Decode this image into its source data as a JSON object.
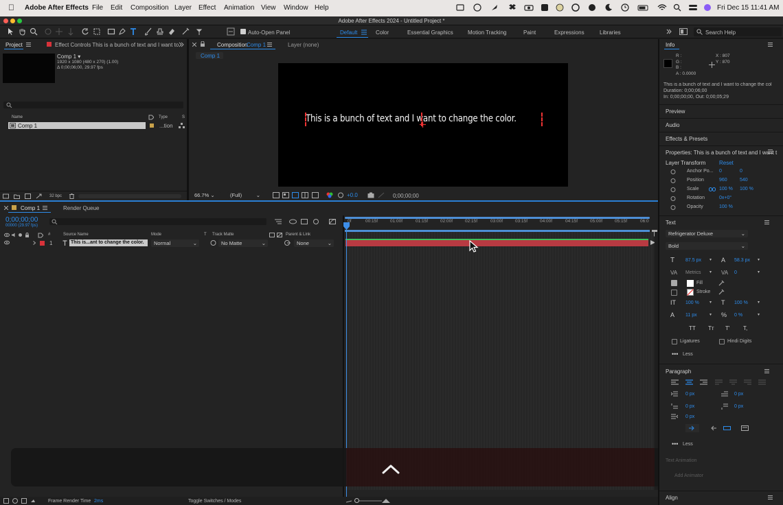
{
  "menubar": {
    "app_name": "Adobe After Effects",
    "items": [
      "File",
      "Edit",
      "Composition",
      "Layer",
      "Effect",
      "Animation",
      "View",
      "Window",
      "Help"
    ],
    "clock": "Fri Dec 15  11:41 AM"
  },
  "window": {
    "title": "Adobe After Effects 2024 - Untitled Project *"
  },
  "toolbar": {
    "auto_open_panel": "Auto-Open Panel",
    "workspaces": [
      "Default",
      "Color",
      "Essential Graphics",
      "Motion Tracking",
      "Paint",
      "Expressions",
      "Libraries"
    ],
    "active_workspace": "Default",
    "search_placeholder": "Search Help"
  },
  "project": {
    "tab_label": "Project",
    "effect_controls_label": "Effect Controls This is a bunch of text and I want to",
    "comp_name": "Comp 1 ▾",
    "comp_size": "1920 x 1080  (480 x 270) (1.00)",
    "comp_duration": "Δ 0;00;06;00, 29.97 fps",
    "col_name": "Name",
    "col_type": "Type",
    "col_s": "S",
    "item_name": "Comp 1",
    "item_type": "...tion",
    "bpc": "32 bpc"
  },
  "composition": {
    "tab_prefix": "Composition",
    "tab_name": "Comp 1",
    "layer_tab": "Layer (none)",
    "breadcrumb": "Comp 1",
    "canvas_text": "This is a bunch of text and I want to change the color.",
    "zoom": "66.7%",
    "resolution": "(Full)",
    "exposure": "+0.0",
    "timecode": "0;00;00;00"
  },
  "info": {
    "title": "Info",
    "r": "R :",
    "g": "G :",
    "b": "B :",
    "a": "A : 0.0000",
    "x": "X : 807",
    "y": "Y : 870",
    "layer_line": "This is a bunch of text and I want to change the col",
    "duration": "Duration: 0;00;06;00",
    "in_out": "In: 0;00;00;00, Out: 0;00;05;29",
    "preview": "Preview",
    "audio": "Audio",
    "effects": "Effects & Presets",
    "properties": "Properties: This is a bunch of text and I want t",
    "layer_transform": "Layer Transform",
    "reset": "Reset",
    "anchor_label": "Anchor Po...",
    "anchor_x": "0",
    "anchor_y": "0",
    "position_label": "Position",
    "position_x": "960",
    "position_y": "540",
    "scale_label": "Scale",
    "scale_x": "100 %",
    "scale_y": "100 %",
    "rotation_label": "Rotation",
    "rotation": "0x+0°",
    "opacity_label": "Opacity",
    "opacity": "100 %",
    "text_title": "Text",
    "font": "Refrigerator Deluxe",
    "style": "Bold",
    "font_size": "87.5 px",
    "leading": "58.3 px",
    "kerning": "Metrics",
    "tracking": "0",
    "fill": "Fill",
    "stroke": "Stroke",
    "vscale": "100 %",
    "hscale": "100 %",
    "baseline": "11 px",
    "tsume": "0 %",
    "ligatures": "Ligatures",
    "hindi": "Hindi Digits",
    "less": "Less",
    "paragraph": "Paragraph",
    "indent_left": "0 px",
    "indent_first": "0 px",
    "space_before": "0 px",
    "space_after": "0 px",
    "indent_right": "0 px",
    "less2": "Less",
    "text_animation": "Text Animation",
    "add_animator": "Add Animator",
    "align": "Align"
  },
  "timeline": {
    "tab_label": "Comp 1",
    "render_queue": "Render Queue",
    "timecode": "0;00;00;00",
    "fps": "00000 (29.97 fps)",
    "col_source": "Source Name",
    "col_mode": "Mode",
    "col_t": "T",
    "col_matte": "Track Matte",
    "col_parent": "Parent & Link",
    "layer_index": "1",
    "layer_name": "This is...ant to change the color.",
    "layer_mode": "Normal",
    "layer_matte": "No Matte",
    "layer_parent": "None",
    "ticks": [
      "0f",
      "00:15f",
      "01:00f",
      "01:15f",
      "02:00f",
      "02:15f",
      "03:00f",
      "03:15f",
      "04:00f",
      "04:15f",
      "05:00f",
      "05:15f",
      "06:0"
    ]
  },
  "status": {
    "render_label": "Frame Render Time",
    "render_value": "2ms",
    "toggle": "Toggle Switches / Modes"
  },
  "colors": {
    "accent": "#2d8ceb",
    "layer_bar": "#b83a42",
    "label_red": "#d8323a"
  }
}
